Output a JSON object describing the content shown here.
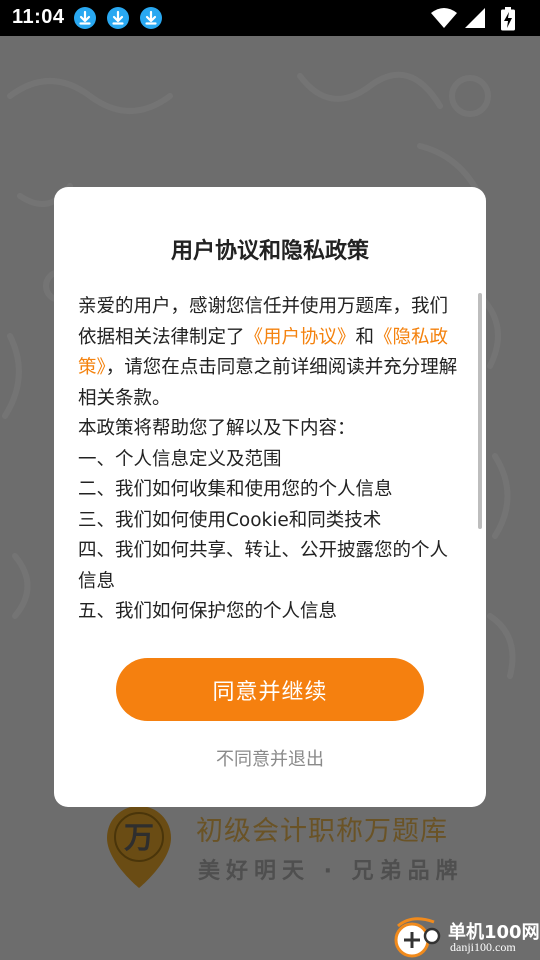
{
  "status_bar": {
    "time": "11:04",
    "notification_icons": [
      "download-icon",
      "download-icon",
      "download-icon"
    ],
    "system_icons": [
      "wifi-icon",
      "signal-icon",
      "battery-charging-icon"
    ],
    "download_icon_color": "#29a8f1"
  },
  "background_app": {
    "logo_glyph": "万",
    "brand_name": "初级会计职称万题库",
    "brand_slogan": "美好明天 · 兄弟品牌",
    "brand_color": "#f5a623"
  },
  "dialog": {
    "title": "用户协议和隐私政策",
    "intro_1": "亲爱的用户，感谢您信任并使用万题库，我们依据相关法律制定了",
    "link_user_agreement": "《用户协议》",
    "intro_and": "和",
    "link_privacy_policy": "《隐私政策》",
    "intro_2": "，请您在点击同意之前详细阅读并充分理解相关条款。",
    "list_intro": "本政策将帮助您了解以及下内容：",
    "items": [
      "一、个人信息定义及范围",
      "二、我们如何收集和使用您的个人信息",
      "三、我们如何使用Cookie和同类技术",
      "四、我们如何共享、转让、公开披露您的个人信息",
      "五、我们如何保护您的个人信息"
    ],
    "agree_button": "同意并继续",
    "disagree_button": "不同意并退出",
    "accent_color": "#f5800f"
  },
  "watermark": {
    "site_name": "单机100网",
    "site_url": "danji100.com"
  }
}
